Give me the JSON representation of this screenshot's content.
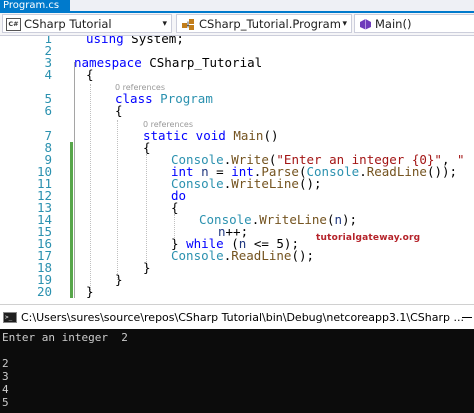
{
  "tab": {
    "title": "Program.cs"
  },
  "navbar": {
    "project_badge": "C#",
    "project": "CSharp Tutorial",
    "class": "CSharp_Tutorial.Program",
    "member": "Main()",
    "dropdown_glyph": "▾",
    "icons": [
      "csharp-project-icon",
      "class-icon",
      "method-icon"
    ]
  },
  "editor": {
    "line_numbers": [
      "1",
      "2",
      "3",
      "4",
      "5",
      "6",
      "7",
      "8",
      "9",
      "10",
      "11",
      "12",
      "13",
      "14",
      "15",
      "16",
      "17",
      "18",
      "19",
      "20"
    ],
    "references": [
      "0 references",
      "0 references"
    ],
    "lines": {
      "l1": {
        "kw": "using",
        "text": " System;"
      },
      "l3": {
        "kw": "namespace",
        "text": " CSharp_Tutorial"
      },
      "l4": {
        "text": "{"
      },
      "l5": {
        "kw": "class",
        "ty": " Program"
      },
      "l6": {
        "text": "{"
      },
      "l7": {
        "kw": "static void",
        "mt": " Main",
        "text": "()"
      },
      "l8": {
        "text": "{"
      },
      "l9": {
        "ty": "Console",
        "p1": ".",
        "mt": "Write",
        "p2": "(",
        "st1": "\"Enter an integer {0}\"",
        "p3": ", ",
        "st2": "\" \"",
        "p4": ");"
      },
      "l10": {
        "kw": "int",
        "p1": " ",
        "id": "n",
        "p2": " = ",
        "kw2": "int",
        "p3": ".",
        "mt": "Parse",
        "p4": "(",
        "ty": "Console",
        "p5": ".",
        "mt2": "ReadLine",
        "p6": "());"
      },
      "l11": {
        "ty": "Console",
        "p1": ".",
        "mt": "WriteLine",
        "p2": "();"
      },
      "l12": {
        "kw": "do"
      },
      "l13": {
        "text": "{"
      },
      "l14": {
        "ty": "Console",
        "p1": ".",
        "mt": "WriteLine",
        "p2": "(",
        "id": "n",
        "p3": ");"
      },
      "l15": {
        "id": "n",
        "p1": "++;"
      },
      "l16": {
        "p1": "} ",
        "kw": "while",
        "p2": " (",
        "id": "n",
        "p3": " <= 5);"
      },
      "l17": {
        "ty": "Console",
        "p1": ".",
        "mt": "ReadLine",
        "p2": "();"
      },
      "l18": {
        "text": "}"
      },
      "l19": {
        "text": "}"
      },
      "l20": {
        "text": "}"
      }
    },
    "watermark": "tutorialgateway.org",
    "colors": {
      "keyword": "#0000ff",
      "type": "#2b91af",
      "string": "#a31515",
      "change_bar": "#57a64a"
    }
  },
  "console": {
    "title": "C:\\Users\\sures\\source\\repos\\CSharp Tutorial\\bin\\Debug\\netcoreapp3.1\\CSharp ...",
    "output": [
      "Enter an integer  2",
      "",
      "2",
      "3",
      "4",
      "5"
    ]
  }
}
